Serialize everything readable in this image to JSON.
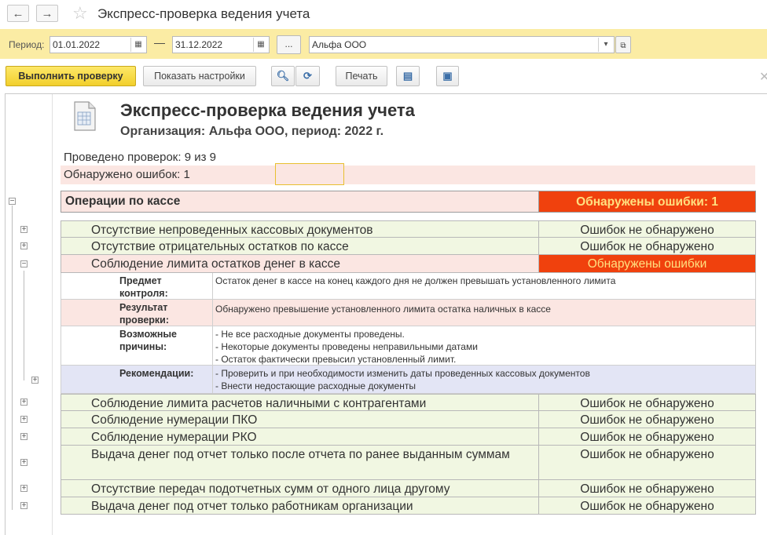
{
  "window": {
    "title": "Экспресс-проверка ведения учета",
    "back_icon": "←",
    "forward_icon": "→",
    "star_icon": "☆"
  },
  "period": {
    "label": "Период:",
    "from": "01.01.2022",
    "dash": "—",
    "to": "31.12.2022",
    "ellipsis": "...",
    "organization": "Альфа ООО"
  },
  "toolbar": {
    "run_label": "Выполнить проверку",
    "settings_label": "Показать настройки",
    "print_label": "Печать"
  },
  "report": {
    "title": "Экспресс-проверка ведения учета",
    "subtitle": "Организация: Альфа ООО, период: 2022 г.",
    "checks_done": "Проведено проверок: 9 из 9",
    "errors_found": "Обнаружено ошибок: 1",
    "section": {
      "name": "Операции по кассе",
      "status": "Обнаружены ошибки: 1"
    },
    "rows": [
      {
        "name": "Отсутствие непроведенных кассовых документов",
        "status": "Ошибок не обнаружено"
      },
      {
        "name": "Отсутствие отрицательных остатков по кассе",
        "status": "Ошибок не обнаружено"
      },
      {
        "name": "Соблюдение лимита остатков денег в кассе",
        "status": "Обнаружены ошибки"
      },
      {
        "name": "Соблюдение лимита расчетов наличными с контрагентами",
        "status": "Ошибок не обнаружено"
      },
      {
        "name": "Соблюдение нумерации ПКО",
        "status": "Ошибок не обнаружено"
      },
      {
        "name": "Соблюдение нумерации РКО",
        "status": "Ошибок не обнаружено"
      },
      {
        "name": "Выдача денег под отчет только после отчета по ранее выданным суммам",
        "status": "Ошибок не обнаружено"
      },
      {
        "name": "Отсутствие передач подотчетных сумм от одного лица другому",
        "status": "Ошибок не обнаружено"
      },
      {
        "name": "Выдача денег под отчет только работникам организации",
        "status": "Ошибок не обнаружено"
      }
    ],
    "details": {
      "subject_label": "Предмет контроля:",
      "subject_text": "Остаток денег в кассе на конец каждого дня не должен превышать установленного лимита",
      "result_label": "Результат проверки:",
      "result_text": "Обнаружено превышение установленного лимита остатка наличных в кассе",
      "causes_label": "Возможные причины:",
      "causes": [
        "- Не все расходные документы проведены.",
        "- Некоторые документы проведены неправильными датами",
        "- Остаток фактически превысил установленный лимит."
      ],
      "recommend_label": "Рекомендации:",
      "recommendations": [
        "- Проверить и при необходимости изменить даты проведенных кассовых документов",
        "- Внести недостающие расходные документы"
      ]
    }
  },
  "colors": {
    "period_bar": "#fbeca4",
    "ok_row": "#f1f7e2",
    "error_row": "#fbe6e2",
    "error_cell": "#f0410d",
    "error_text": "#ffe080",
    "recommend_row": "#e3e5f5",
    "primary_button": "#f2cf2c"
  }
}
